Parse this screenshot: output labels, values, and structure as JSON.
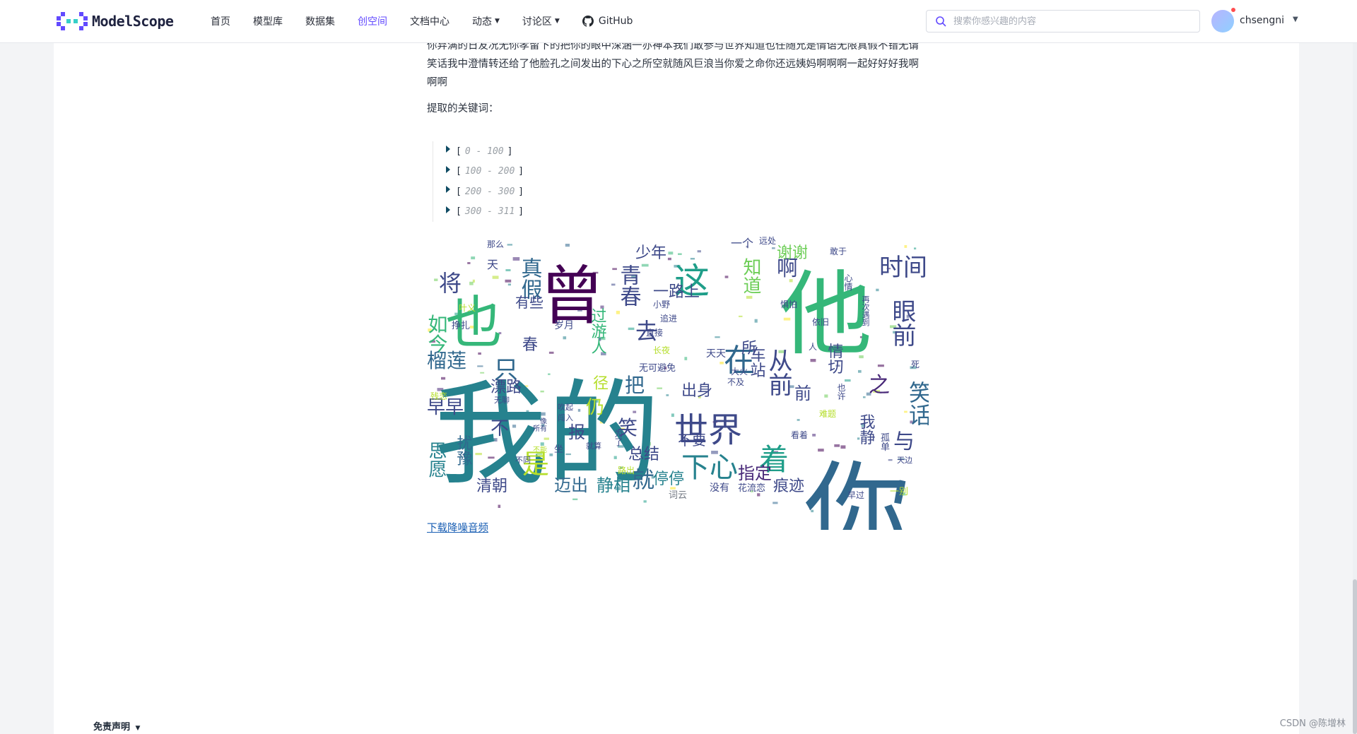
{
  "brand": {
    "name": "ModelScope",
    "color": "#624aff"
  },
  "nav": {
    "items": [
      {
        "label": "首页",
        "active": false,
        "dropdown": false
      },
      {
        "label": "模型库",
        "active": false,
        "dropdown": false
      },
      {
        "label": "数据集",
        "active": false,
        "dropdown": false
      },
      {
        "label": "创空间",
        "active": true,
        "dropdown": false
      },
      {
        "label": "文档中心",
        "active": false,
        "dropdown": false
      },
      {
        "label": "动态",
        "active": false,
        "dropdown": true
      },
      {
        "label": "讨论区",
        "active": false,
        "dropdown": true
      }
    ],
    "github_label": "GitHub"
  },
  "search": {
    "placeholder": "搜索你感兴趣的内容",
    "value": ""
  },
  "user": {
    "name": "chsengni",
    "has_notification": true
  },
  "article": {
    "paragraph": "你弃满的日友况无你孝留下的把你的眼中深涵一亦神本我们敢参与世界知道也任随允是情语无限真假不错无谓笑话我中澄情转还给了他脸孔之间发出的下心之所空就随风巨浪当你爱之命你还远姨妈啊啊啊一起好好好我啊啊啊",
    "keywords_label": "提取的关键词：",
    "ranges": [
      "0 - 100",
      "100 - 200",
      "200 - 300",
      "300 - 311"
    ],
    "caption": "词云",
    "download_label": "下载降噪音频"
  },
  "wordcloud": {
    "colors": [
      "#440154",
      "#482878",
      "#3e4989",
      "#31688e",
      "#26828e",
      "#1f9e89",
      "#35b779",
      "#6ece58",
      "#b5de2b",
      "#fde725"
    ],
    "words": [
      {
        "text": "我的",
        "color": "#26828e"
      },
      {
        "text": "你",
        "color": "#31688e"
      },
      {
        "text": "他",
        "color": "#35b779"
      },
      {
        "text": "曾",
        "color": "#440154"
      },
      {
        "text": "也",
        "color": "#35b779"
      },
      {
        "text": "世界",
        "color": "#3e4989"
      },
      {
        "text": "这",
        "color": "#1f9e89"
      },
      {
        "text": "在",
        "color": "#31688e"
      },
      {
        "text": "着",
        "color": "#1f9e89"
      },
      {
        "text": "下心",
        "color": "#26828e"
      },
      {
        "text": "时间",
        "color": "#3e4989"
      },
      {
        "text": "眼前",
        "color": "#3e4989"
      },
      {
        "text": "笑话",
        "color": "#31688e"
      },
      {
        "text": "从前",
        "color": "#3e4989"
      },
      {
        "text": "之",
        "color": "#482878"
      },
      {
        "text": "与",
        "color": "#3e4989"
      },
      {
        "text": "真假",
        "color": "#31688e"
      },
      {
        "text": "青春",
        "color": "#3e4989"
      },
      {
        "text": "将",
        "color": "#3e4989"
      },
      {
        "text": "如今",
        "color": "#35b779"
      },
      {
        "text": "榴莲",
        "color": "#31688e"
      },
      {
        "text": "只",
        "color": "#31688e"
      },
      {
        "text": "早早",
        "color": "#3e4989"
      },
      {
        "text": "思愿",
        "color": "#26828e"
      },
      {
        "text": "是",
        "color": "#b5de2b"
      },
      {
        "text": "清朝",
        "color": "#3e4989"
      },
      {
        "text": "迈出",
        "color": "#31688e"
      },
      {
        "text": "静相",
        "color": "#26828e"
      },
      {
        "text": "就",
        "color": "#31688e"
      },
      {
        "text": "停停",
        "color": "#26828e"
      },
      {
        "text": "指定",
        "color": "#482878"
      },
      {
        "text": "痕迹",
        "color": "#3e4989"
      },
      {
        "text": "少年",
        "color": "#3e4989"
      },
      {
        "text": "一路上",
        "color": "#3e4989"
      },
      {
        "text": "知道",
        "color": "#6ece58"
      },
      {
        "text": "啊",
        "color": "#3e4989"
      },
      {
        "text": "谢谢",
        "color": "#6ece58"
      },
      {
        "text": "去",
        "color": "#3e4989"
      },
      {
        "text": "把",
        "color": "#31688e"
      },
      {
        "text": "笑",
        "color": "#3e4989"
      },
      {
        "text": "出身",
        "color": "#3e4989"
      },
      {
        "text": "不要",
        "color": "#3e4989"
      },
      {
        "text": "总结",
        "color": "#3e4989"
      },
      {
        "text": "漂路",
        "color": "#3e4989"
      },
      {
        "text": "仍",
        "color": "#b5de2b"
      },
      {
        "text": "报",
        "color": "#3e4989"
      },
      {
        "text": "春",
        "color": "#3e4989"
      },
      {
        "text": "有些",
        "color": "#3e4989"
      },
      {
        "text": "过游人",
        "color": "#35b779"
      },
      {
        "text": "所",
        "color": "#3e4989"
      },
      {
        "text": "车站",
        "color": "#3e4989"
      },
      {
        "text": "我静",
        "color": "#3e4989"
      },
      {
        "text": "情切",
        "color": "#3e4989"
      },
      {
        "text": "扰豫",
        "color": "#31688e"
      },
      {
        "text": "不",
        "color": "#3e4989"
      },
      {
        "text": "前",
        "color": "#3e4989"
      },
      {
        "text": "径",
        "color": "#b5de2b"
      },
      {
        "text": "天天",
        "color": "#3e4989"
      },
      {
        "text": "无可避免",
        "color": "#3e4989"
      },
      {
        "text": "一个",
        "color": "#3e4989"
      },
      {
        "text": "远处",
        "color": "#3e4989"
      },
      {
        "text": "花流恋",
        "color": "#3e4989"
      },
      {
        "text": "没有",
        "color": "#3e4989"
      },
      {
        "text": "岁月",
        "color": "#3e4989"
      },
      {
        "text": "那么",
        "color": "#3e4989"
      },
      {
        "text": "天",
        "color": "#3e4989"
      },
      {
        "text": "叶义",
        "color": "#b5de2b"
      },
      {
        "text": "挣扎",
        "color": "#3e4989"
      },
      {
        "text": "无聊",
        "color": "#3e4989"
      },
      {
        "text": "看着",
        "color": "#3e4989"
      },
      {
        "text": "孤单",
        "color": "#3e4989"
      },
      {
        "text": "敢于",
        "color": "#3e4989"
      },
      {
        "text": "残恋",
        "color": "#b5de2b"
      },
      {
        "text": "一别",
        "color": "#b5de2b"
      },
      {
        "text": "早过",
        "color": "#3e4989"
      },
      {
        "text": "依旧",
        "color": "#3e4989"
      },
      {
        "text": "惧怕",
        "color": "#3e4989"
      },
      {
        "text": "长夜",
        "color": "#b5de2b"
      },
      {
        "text": "小野",
        "color": "#3e4989"
      },
      {
        "text": "追进",
        "color": "#3e4989"
      },
      {
        "text": "直接",
        "color": "#3e4989"
      },
      {
        "text": "路出",
        "color": "#b5de2b"
      },
      {
        "text": "为了",
        "color": "#3e4989"
      },
      {
        "text": "大火",
        "color": "#3e4989"
      },
      {
        "text": "不及",
        "color": "#3e4989"
      },
      {
        "text": "心情",
        "color": "#3e4989"
      },
      {
        "text": "再次遇到",
        "color": "#3e4989"
      },
      {
        "text": "人",
        "color": "#3e4989"
      },
      {
        "text": "也许",
        "color": "#3e4989"
      },
      {
        "text": "难题",
        "color": "#b5de2b"
      },
      {
        "text": "死",
        "color": "#3e4989"
      },
      {
        "text": "天边",
        "color": "#3e4989"
      },
      {
        "text": "吹起",
        "color": "#3e4989"
      },
      {
        "text": "闯入",
        "color": "#3e4989"
      },
      {
        "text": "坐",
        "color": "#3e4989"
      },
      {
        "text": "不同",
        "color": "#3e4989"
      },
      {
        "text": "就算",
        "color": "#3e4989"
      },
      {
        "text": "不能",
        "color": "#b5de2b"
      },
      {
        "text": "所有",
        "color": "#3e4989"
      },
      {
        "text": "像",
        "color": "#3e4989"
      }
    ]
  },
  "footer": {
    "disclaimer_label": "免责声明"
  },
  "watermark": "CSDN @陈增林"
}
